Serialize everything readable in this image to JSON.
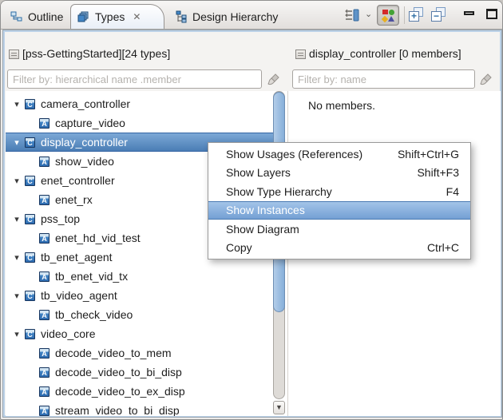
{
  "tabs": [
    {
      "label": "Outline",
      "active": false
    },
    {
      "label": "Types",
      "active": true,
      "close_glyph": "✕"
    },
    {
      "label": "Design Hierarchy",
      "active": false
    }
  ],
  "toolbar": {
    "view_menu_icon": "layout-options-icon",
    "dropdown_glyph": "⌄",
    "filter_kinds_button": "type-kind-filter-button (pressed)",
    "expand_all": "expand-all",
    "collapse_all": "collapse-all",
    "minimize": "minimize",
    "maximize": "maximize",
    "expand_glyph": "+",
    "collapse_glyph": "−"
  },
  "left_panel": {
    "header": "[pss-GettingStarted][24 types]",
    "filter_placeholder": "Filter by: hierarchical name .member",
    "tree": [
      {
        "label": "camera_controller",
        "kind": "C",
        "level": 0,
        "expanded": true
      },
      {
        "label": "capture_video",
        "kind": "A",
        "level": 1
      },
      {
        "label": "display_controller",
        "kind": "C",
        "level": 0,
        "expanded": true,
        "selected": true
      },
      {
        "label": "show_video",
        "kind": "A",
        "level": 1
      },
      {
        "label": "enet_controller",
        "kind": "C",
        "level": 0,
        "expanded": true
      },
      {
        "label": "enet_rx",
        "kind": "A",
        "level": 1
      },
      {
        "label": "pss_top",
        "kind": "C",
        "level": 0,
        "expanded": true
      },
      {
        "label": "enet_hd_vid_test",
        "kind": "A",
        "level": 1
      },
      {
        "label": "tb_enet_agent",
        "kind": "C",
        "level": 0,
        "expanded": true
      },
      {
        "label": "tb_enet_vid_tx",
        "kind": "A",
        "level": 1
      },
      {
        "label": "tb_video_agent",
        "kind": "C",
        "level": 0,
        "expanded": true
      },
      {
        "label": "tb_check_video",
        "kind": "A",
        "level": 1
      },
      {
        "label": "video_core",
        "kind": "C",
        "level": 0,
        "expanded": true
      },
      {
        "label": "decode_video_to_mem",
        "kind": "A",
        "level": 1
      },
      {
        "label": "decode_video_to_bi_disp",
        "kind": "A",
        "level": 1
      },
      {
        "label": "decode_video_to_ex_disp",
        "kind": "A",
        "level": 1
      },
      {
        "label": "stream_video_to_bi_disp",
        "kind": "A",
        "level": 1
      }
    ]
  },
  "right_panel": {
    "header": "display_controller [0 members]",
    "filter_placeholder": "Filter by: name",
    "empty_text": "No members."
  },
  "context_menu": {
    "items": [
      {
        "label": "Show Usages (References)",
        "shortcut": "Shift+Ctrl+G",
        "highlighted": false
      },
      {
        "label": "Show Layers",
        "shortcut": "Shift+F3",
        "highlighted": false
      },
      {
        "label": "Show Type Hierarchy",
        "shortcut": "F4",
        "highlighted": false
      },
      {
        "label": "Show Instances",
        "shortcut": "",
        "highlighted": true
      },
      {
        "label": "Show Diagram",
        "shortcut": "",
        "highlighted": false
      },
      {
        "label": "Copy",
        "shortcut": "Ctrl+C",
        "highlighted": false
      }
    ]
  },
  "colors": {
    "selection_top": "#7ca8d6",
    "selection_bottom": "#4a7db5",
    "selection_border": "#3465a4",
    "menu_highlight_top": "#a3c4e8",
    "menu_highlight_bottom": "#74a0d4",
    "view_focus_border": "#bcd2e8",
    "badge_blue": "#4386c6"
  }
}
